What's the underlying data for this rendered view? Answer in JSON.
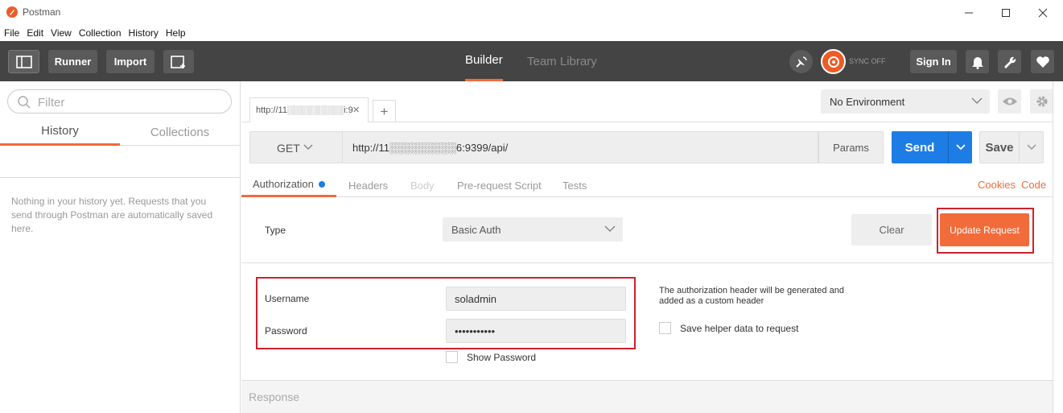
{
  "window": {
    "title": "Postman",
    "controls": {
      "minimize": "—",
      "maximize": "☐",
      "close": "✕"
    }
  },
  "menu": [
    "File",
    "Edit",
    "View",
    "Collection",
    "History",
    "Help"
  ],
  "toolbar": {
    "runner_label": "Runner",
    "import_label": "Import",
    "tabs": [
      "Builder",
      "Team Library"
    ],
    "sync_label": "SYNC OFF",
    "sign_in_label": "Sign In"
  },
  "sidebar": {
    "filter_placeholder": "Filter",
    "tabs": [
      "History",
      "Collections"
    ],
    "empty_message": "Nothing in your history yet. Requests that you send through Postman are automatically saved here."
  },
  "request_tab": {
    "label": "http://11░░░░░░░░░i:9",
    "close": "×",
    "add": "+"
  },
  "environment": {
    "selected": "No Environment"
  },
  "request": {
    "method": "GET",
    "url": "http://11░░░░░░░░░6:9399/api/",
    "params_label": "Params",
    "send_label": "Send",
    "save_label": "Save"
  },
  "subtabs": {
    "items": [
      "Authorization",
      "Headers",
      "Body",
      "Pre-request Script",
      "Tests"
    ],
    "cookies_label": "Cookies",
    "code_label": "Code"
  },
  "auth": {
    "type_label": "Type",
    "type_value": "Basic Auth",
    "clear_label": "Clear",
    "update_label": "Update Request",
    "username_label": "Username",
    "username_value": "soladmin",
    "password_label": "Password",
    "password_value": "•••••••••••",
    "show_password_label": "Show Password",
    "info_text": "The authorization header will be generated and added as a custom header",
    "save_helper_label": "Save helper data to request"
  },
  "response": {
    "label": "Response"
  },
  "colors": {
    "accent": "#f26b3a",
    "send": "#1d7de4",
    "toolbar": "#444444",
    "highlight_outline": "#d21f2c"
  }
}
